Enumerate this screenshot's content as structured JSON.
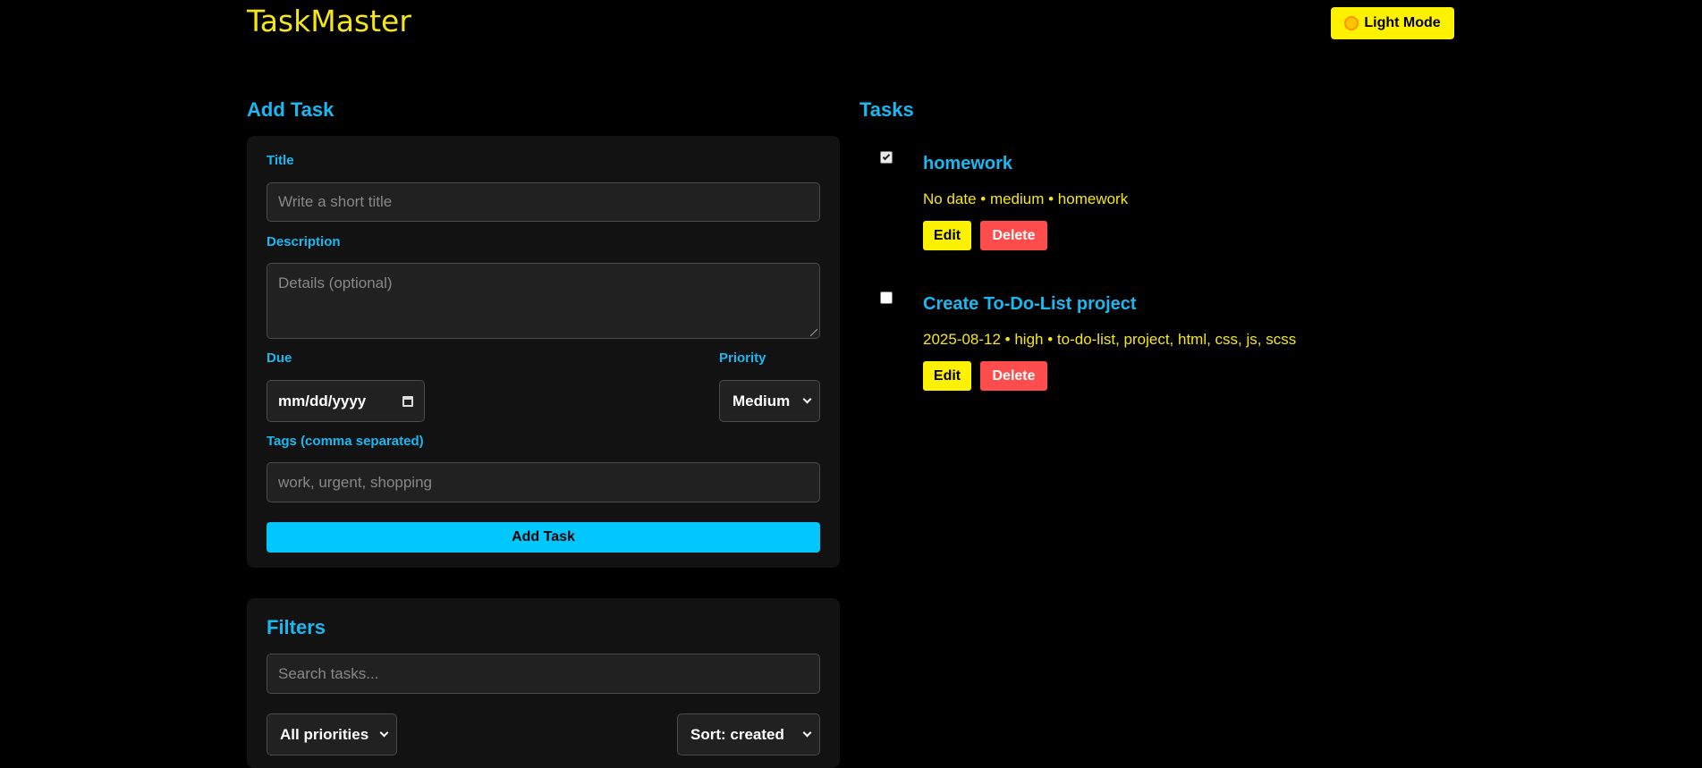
{
  "app": {
    "title": "TaskMaster"
  },
  "header": {
    "theme_toggle_label": "Light Mode",
    "theme_icon": "sun-icon"
  },
  "add_task": {
    "section_title": "Add Task",
    "title_label": "Title",
    "title_placeholder": "Write a short title",
    "description_label": "Description",
    "description_placeholder": "Details (optional)",
    "due_label": "Due",
    "due_placeholder": "mm/dd/yyyy",
    "priority_label": "Priority",
    "priority_selected": "Medium",
    "tags_label": "Tags (comma separated)",
    "tags_placeholder": "work, urgent, shopping",
    "submit_label": "Add Task"
  },
  "filters": {
    "section_title": "Filters",
    "search_placeholder": "Search tasks...",
    "priority_filter_selected": "All priorities",
    "sort_selected": "Sort: created"
  },
  "tasks": {
    "section_title": "Tasks",
    "items": [
      {
        "title": "homework",
        "meta": "No date • medium • homework",
        "completed": true,
        "edit_label": "Edit",
        "delete_label": "Delete"
      },
      {
        "title": "Create To-Do-List project",
        "meta": "2025-08-12 • high • to-do-list, project, html, css, js, scss",
        "completed": false,
        "edit_label": "Edit",
        "delete_label": "Delete"
      }
    ]
  },
  "colors": {
    "background": "#000000",
    "accent_blue": "#1ab8f0",
    "accent_yellow": "#f5e616",
    "button_yellow": "#fff200",
    "button_red": "#ff4d4d",
    "button_cyan": "#00c8ff",
    "panel": "#121212"
  }
}
